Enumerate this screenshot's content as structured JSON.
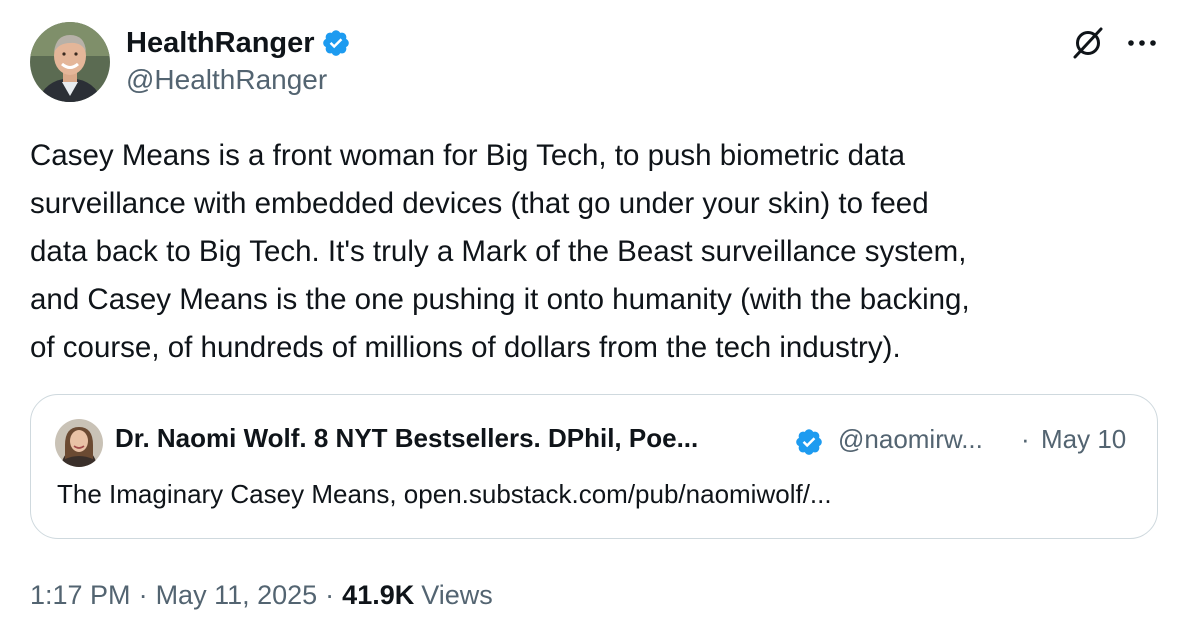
{
  "author": {
    "display_name": "HealthRanger",
    "handle": "@HealthRanger",
    "verified": true
  },
  "tweet": {
    "text": "Casey Means is a front woman for Big Tech, to push biometric data\nsurveillance with embedded devices (that go under your skin) to feed\ndata back to Big Tech. It's truly a Mark of the Beast surveillance system,\nand Casey Means is the one pushing it onto humanity (with the backing,\nof course, of hundreds of millions of dollars from the tech industry)."
  },
  "quote": {
    "display_name": "Dr. Naomi Wolf. 8 NYT Bestsellers. DPhil, Poe...",
    "handle": "@naomirw...",
    "dot": "·",
    "date": "May 10",
    "text": "The Imaginary Casey Means, open.substack.com/pub/naomiwolf/...",
    "verified": true
  },
  "meta": {
    "time": "1:17 PM",
    "separator": "·",
    "date": "May 11, 2025",
    "views_count": "41.9K",
    "views_label": "Views"
  },
  "icons": {
    "grok": "grok-icon",
    "more": "more-icon",
    "verified": "verified-badge-icon"
  },
  "colors": {
    "verified_blue": "#1d9bf0",
    "secondary_text": "#536471",
    "primary_text": "#0f1419",
    "border": "#cfd9de"
  }
}
